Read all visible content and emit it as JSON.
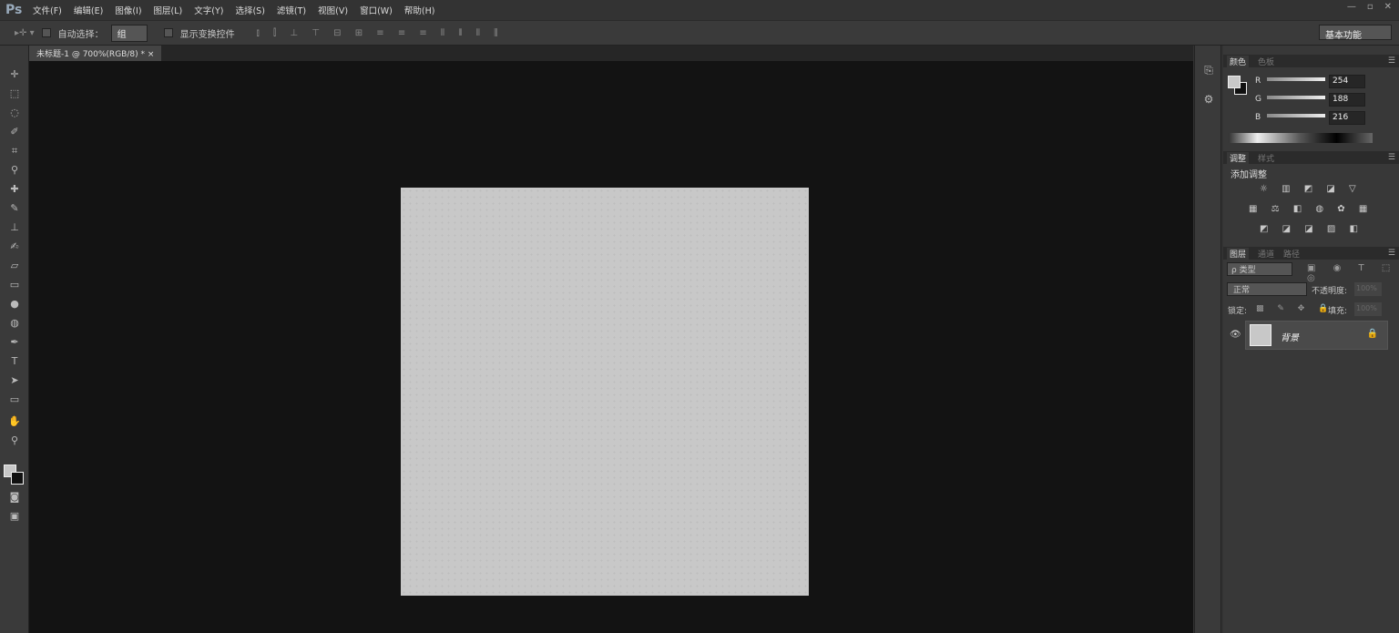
{
  "app": {
    "logo": "Ps"
  },
  "menu": [
    "文件(F)",
    "编辑(E)",
    "图像(I)",
    "图层(L)",
    "文字(Y)",
    "选择(S)",
    "滤镜(T)",
    "视图(V)",
    "窗口(W)",
    "帮助(H)"
  ],
  "window_controls": [
    "—",
    "▫",
    "✕"
  ],
  "options": {
    "tool_icon": "▸✛ ▾",
    "auto_select_label": "自动选择：",
    "auto_select_value": "组",
    "show_transform_label": "显示变换控件",
    "align_icons": "⫾ ⫿ ⊥ ⊤ ⊟ ⊞  ≡ ≡ ≡ ⫴ ⫴ ⫴  ⫼",
    "workspace": "基本功能"
  },
  "document": {
    "tab_title": "未标题-1 @ 700%(RGB/8) *",
    "close": "×",
    "bg_color": "#c8c8c8"
  },
  "panels": {
    "color": {
      "tabs": [
        "颜色",
        "色板"
      ],
      "channels": [
        {
          "label": "R",
          "value": "254",
          "fraction": 0.996
        },
        {
          "label": "G",
          "value": "188",
          "fraction": 0.737
        },
        {
          "label": "B",
          "value": "216",
          "fraction": 0.847
        }
      ]
    },
    "adjustments": {
      "tabs": [
        "调整",
        "样式"
      ],
      "title": "添加调整",
      "row1": "☼ ▥ ◩ ◪ ▽",
      "row2": "▦ ⚖ ◧ ◍ ✿ ▦",
      "row3": "◩ ◪ ◪ ▨ ◧"
    },
    "layers": {
      "tabs": [
        "图层",
        "通道",
        "路径"
      ],
      "filter": "ρ 类型",
      "filter_icons": "▣ ◉ T ⬚ ◎",
      "blend_mode": "正常",
      "opacity_label": "不透明度:",
      "opacity_value": "100%",
      "lock_label": "锁定:",
      "lock_icons": "▩ ✎ ✥ 🔒",
      "fill_label": "填充:",
      "fill_value": "100%",
      "layer_name": "背景"
    }
  }
}
